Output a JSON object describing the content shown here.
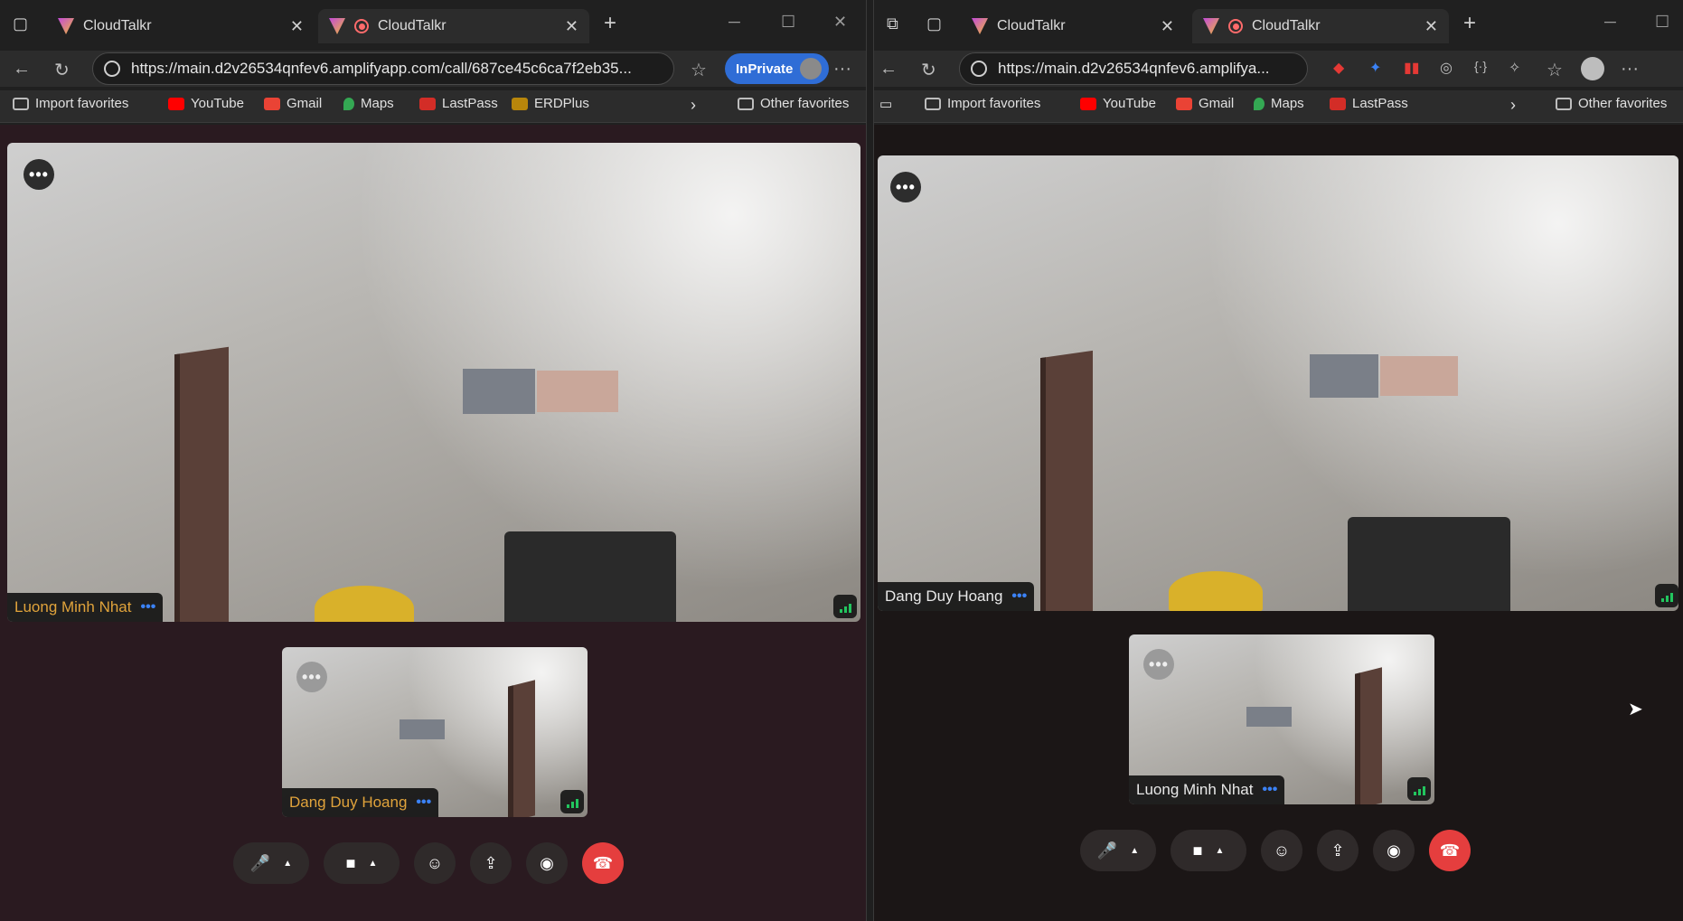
{
  "left": {
    "tabs": [
      {
        "label": "CloudTalkr"
      },
      {
        "label": "CloudTalkr"
      }
    ],
    "url": "https://main.d2v26534qnfev6.amplifyapp.com/call/687ce45c6ca7f2eb35...",
    "inprivate_label": "InPrivate",
    "bookmarks": [
      {
        "label": "Import favorites",
        "color": "#9a9a9a"
      },
      {
        "label": "YouTube",
        "color": "#ff0000"
      },
      {
        "label": "Gmail",
        "color": "#ea4335"
      },
      {
        "label": "Maps",
        "color": "#34a853"
      },
      {
        "label": "LastPass",
        "color": "#d32d27"
      },
      {
        "label": "ERDPlus",
        "color": "#b8860b"
      }
    ],
    "other_favorites": "Other favorites",
    "main_participant": "Luong Minh Nhat",
    "self_participant": "Dang Duy Hoang"
  },
  "right": {
    "tabs": [
      {
        "label": "CloudTalkr"
      },
      {
        "label": "CloudTalkr"
      }
    ],
    "url": "https://main.d2v26534qnfev6.amplifya...",
    "bookmarks": [
      {
        "label": "Import favorites",
        "color": "#9a9a9a"
      },
      {
        "label": "YouTube",
        "color": "#ff0000"
      },
      {
        "label": "Gmail",
        "color": "#ea4335"
      },
      {
        "label": "Maps",
        "color": "#34a853"
      },
      {
        "label": "LastPass",
        "color": "#d32d27"
      }
    ],
    "other_favorites": "Other favorites",
    "main_participant": "Dang Duy Hoang",
    "self_participant": "Luong Minh Nhat"
  },
  "icons": {
    "more": "•••",
    "mic": "🎤",
    "camera": "■",
    "emoji": "☺",
    "share": "⇪",
    "record": "◉",
    "hangup": "☎",
    "caret": "▲"
  },
  "colors": {
    "accent": "#3b82f6",
    "signal": "#22c55e",
    "end_call": "#e53e3e",
    "name_highlight": "#e0a33b"
  }
}
